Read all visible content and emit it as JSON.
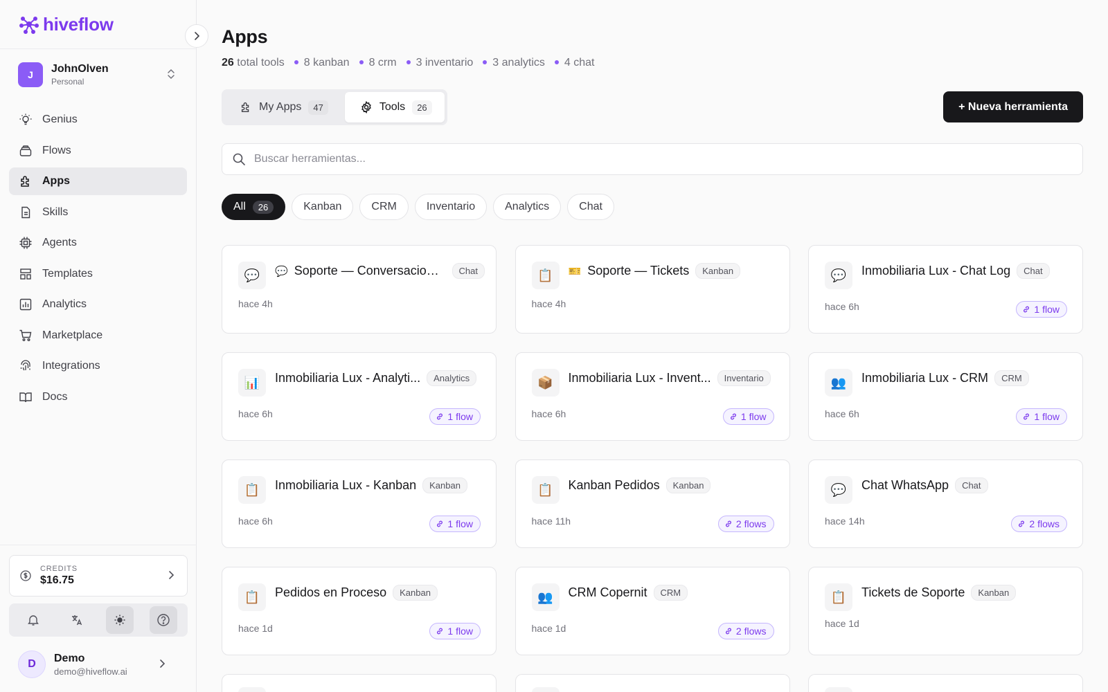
{
  "app": {
    "brand": "hiveflow"
  },
  "workspace": {
    "initial": "J",
    "name": "JohnOlven",
    "type": "Personal"
  },
  "nav": [
    {
      "label": "Genius",
      "icon": "bulb-icon",
      "active": false
    },
    {
      "label": "Flows",
      "icon": "layers-icon",
      "active": false
    },
    {
      "label": "Apps",
      "icon": "puzzle-icon",
      "active": true
    },
    {
      "label": "Skills",
      "icon": "document-icon",
      "active": false
    },
    {
      "label": "Agents",
      "icon": "chip-icon",
      "active": false
    },
    {
      "label": "Templates",
      "icon": "layout-icon",
      "active": false
    },
    {
      "label": "Analytics",
      "icon": "chart-icon",
      "active": false
    },
    {
      "label": "Marketplace",
      "icon": "cart-icon",
      "active": false
    },
    {
      "label": "Integrations",
      "icon": "fingerprint-icon",
      "active": false
    },
    {
      "label": "Docs",
      "icon": "book-icon",
      "active": false
    }
  ],
  "credits": {
    "label": "CREDITS",
    "value": "$16.75"
  },
  "user": {
    "initial": "D",
    "name": "Demo",
    "email": "demo@hiveflow.ai"
  },
  "page": {
    "title": "Apps",
    "stats": {
      "total_count": "26",
      "total_label": "total tools",
      "items": [
        "8 kanban",
        "8 crm",
        "3 inventario",
        "3 analytics",
        "4 chat"
      ]
    },
    "tabs": [
      {
        "label": "My Apps",
        "count": "47",
        "active": false
      },
      {
        "label": "Tools",
        "count": "26",
        "active": true
      }
    ],
    "new_button": "+ Nueva herramienta",
    "search_placeholder": "Buscar herramientas...",
    "filters": [
      {
        "label": "All",
        "count": "26",
        "active": true
      },
      {
        "label": "Kanban",
        "active": false
      },
      {
        "label": "CRM",
        "active": false
      },
      {
        "label": "Inventario",
        "active": false
      },
      {
        "label": "Analytics",
        "active": false
      },
      {
        "label": "Chat",
        "active": false
      }
    ]
  },
  "cards": [
    {
      "icon": "💬",
      "emoji": "💬",
      "title": "Soporte — Conversaciones",
      "badge": "Chat",
      "time": "hace 4h",
      "flows": ""
    },
    {
      "icon": "📋",
      "emoji": "🎫",
      "title": "Soporte — Tickets",
      "badge": "Kanban",
      "time": "hace 4h",
      "flows": ""
    },
    {
      "icon": "💬",
      "emoji": "",
      "title": "Inmobiliaria Lux - Chat Log",
      "badge": "Chat",
      "time": "hace 6h",
      "flows": "1 flow"
    },
    {
      "icon": "📊",
      "emoji": "",
      "title": "Inmobiliaria Lux - Analyti...",
      "badge": "Analytics",
      "time": "hace 6h",
      "flows": "1 flow"
    },
    {
      "icon": "📦",
      "emoji": "",
      "title": "Inmobiliaria Lux - Invent...",
      "badge": "Inventario",
      "time": "hace 6h",
      "flows": "1 flow"
    },
    {
      "icon": "👥",
      "emoji": "",
      "title": "Inmobiliaria Lux - CRM",
      "badge": "CRM",
      "time": "hace 6h",
      "flows": "1 flow"
    },
    {
      "icon": "📋",
      "emoji": "",
      "title": "Inmobiliaria Lux - Kanban",
      "badge": "Kanban",
      "time": "hace 6h",
      "flows": "1 flow"
    },
    {
      "icon": "📋",
      "emoji": "",
      "title": "Kanban Pedidos",
      "badge": "Kanban",
      "time": "hace 11h",
      "flows": "2 flows"
    },
    {
      "icon": "💬",
      "emoji": "",
      "title": "Chat WhatsApp",
      "badge": "Chat",
      "time": "hace 14h",
      "flows": "2 flows"
    },
    {
      "icon": "📋",
      "emoji": "",
      "title": "Pedidos en Proceso",
      "badge": "Kanban",
      "time": "hace 1d",
      "flows": "1 flow"
    },
    {
      "icon": "👥",
      "emoji": "",
      "title": "CRM Copernit",
      "badge": "CRM",
      "time": "hace 1d",
      "flows": "2 flows"
    },
    {
      "icon": "📋",
      "emoji": "",
      "title": "Tickets de Soporte",
      "badge": "Kanban",
      "time": "hace 1d",
      "flows": ""
    }
  ]
}
